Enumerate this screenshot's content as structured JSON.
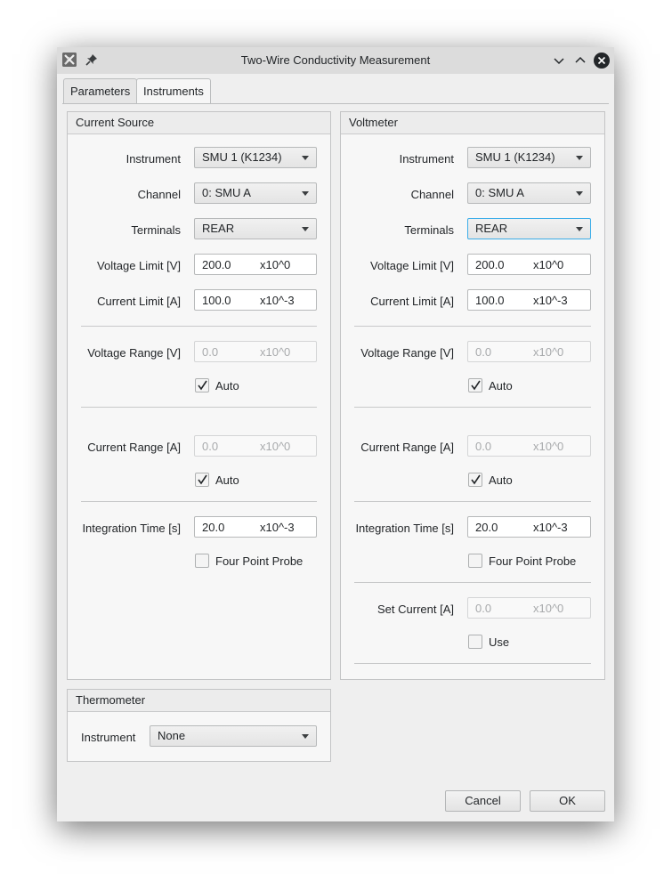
{
  "window": {
    "title": "Two-Wire Conductivity Measurement",
    "icons": [
      "app-icon",
      "pin-icon",
      "minimize-icon",
      "maximize-icon",
      "close-icon"
    ]
  },
  "tabs": [
    {
      "label": "Parameters",
      "active": false
    },
    {
      "label": "Instruments",
      "active": true
    }
  ],
  "current_source": {
    "title": "Current Source",
    "instrument_label": "Instrument",
    "instrument_value": "SMU 1 (K1234)",
    "channel_label": "Channel",
    "channel_value": "0: SMU A",
    "terminals_label": "Terminals",
    "terminals_value": "REAR",
    "voltage_limit_label": "Voltage Limit [V]",
    "voltage_limit_value": "200.0",
    "voltage_limit_exp": "x10^0",
    "current_limit_label": "Current Limit [A]",
    "current_limit_value": "100.0",
    "current_limit_exp": "x10^-3",
    "voltage_range_label": "Voltage Range [V]",
    "voltage_range_value": "0.0",
    "voltage_range_exp": "x10^0",
    "voltage_auto_label": "Auto",
    "voltage_auto_checked": true,
    "current_range_label": "Current Range [A]",
    "current_range_value": "0.0",
    "current_range_exp": "x10^0",
    "current_auto_label": "Auto",
    "current_auto_checked": true,
    "integration_label": "Integration Time [s]",
    "integration_value": "20.0",
    "integration_exp": "x10^-3",
    "four_point_label": "Four Point Probe",
    "four_point_checked": false
  },
  "voltmeter": {
    "title": "Voltmeter",
    "instrument_label": "Instrument",
    "instrument_value": "SMU 1 (K1234)",
    "channel_label": "Channel",
    "channel_value": "0: SMU A",
    "terminals_label": "Terminals",
    "terminals_value": "REAR",
    "voltage_limit_label": "Voltage Limit [V]",
    "voltage_limit_value": "200.0",
    "voltage_limit_exp": "x10^0",
    "current_limit_label": "Current Limit [A]",
    "current_limit_value": "100.0",
    "current_limit_exp": "x10^-3",
    "voltage_range_label": "Voltage Range [V]",
    "voltage_range_value": "0.0",
    "voltage_range_exp": "x10^0",
    "voltage_auto_label": "Auto",
    "voltage_auto_checked": true,
    "current_range_label": "Current Range [A]",
    "current_range_value": "0.0",
    "current_range_exp": "x10^0",
    "current_auto_label": "Auto",
    "current_auto_checked": true,
    "integration_label": "Integration Time [s]",
    "integration_value": "20.0",
    "integration_exp": "x10^-3",
    "four_point_label": "Four Point Probe",
    "four_point_checked": false,
    "set_current_label": "Set Current [A]",
    "set_current_value": "0.0",
    "set_current_exp": "x10^0",
    "use_label": "Use",
    "use_checked": false
  },
  "thermometer": {
    "title": "Thermometer",
    "instrument_label": "Instrument",
    "instrument_value": "None"
  },
  "buttons": {
    "cancel": "Cancel",
    "ok": "OK"
  },
  "colors": {
    "accent": "#3daee9",
    "window_bg": "#efefef",
    "titlebar_bg": "#dcdcdc"
  }
}
